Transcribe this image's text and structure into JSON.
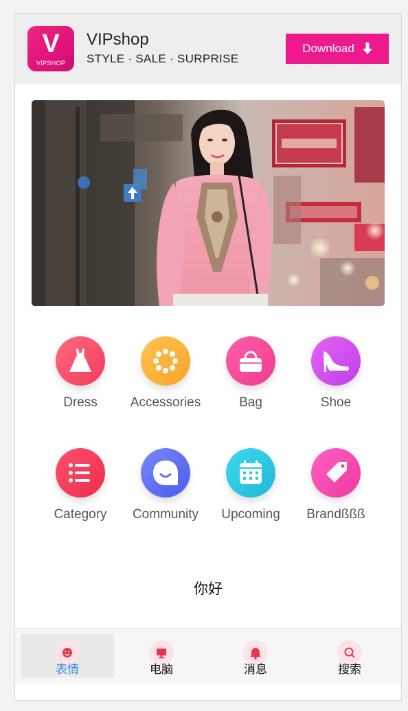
{
  "app": {
    "logo_letter": "V",
    "logo_text": "VIPSHOP",
    "name": "VIPshop",
    "tagline": "STYLE · SALE · SURPRISE",
    "download_label": "Download"
  },
  "colors": {
    "brand": "#ec1a8c",
    "active_tab": "#2f8ee6",
    "tab_icon": "#e8354f"
  },
  "categories": [
    {
      "label": "Dress",
      "icon": "dress-icon",
      "color": "#f7456a"
    },
    {
      "label": "Accessories",
      "icon": "accessories-icon",
      "color": "#fdb33b"
    },
    {
      "label": "Bag",
      "icon": "bag-icon",
      "color": "#f7479b"
    },
    {
      "label": "Shoe",
      "icon": "shoe-icon",
      "color": "#d74af0"
    },
    {
      "label": "Category",
      "icon": "list-icon",
      "color": "#f73a5a"
    },
    {
      "label": "Community",
      "icon": "chat-bubble-icon",
      "color": "#5d6ff2"
    },
    {
      "label": "Upcoming",
      "icon": "calendar-icon",
      "color": "#2cc9e2"
    },
    {
      "label": "Brandßßß",
      "icon": "tag-icon",
      "color": "#f74bb8"
    }
  ],
  "greeting": "你好",
  "tabs": [
    {
      "label": "表情",
      "icon": "emoji-icon",
      "active": true
    },
    {
      "label": "电脑",
      "icon": "computer-icon",
      "active": false
    },
    {
      "label": "消息",
      "icon": "bell-icon",
      "active": false
    },
    {
      "label": "搜索",
      "icon": "search-icon",
      "active": false
    }
  ]
}
